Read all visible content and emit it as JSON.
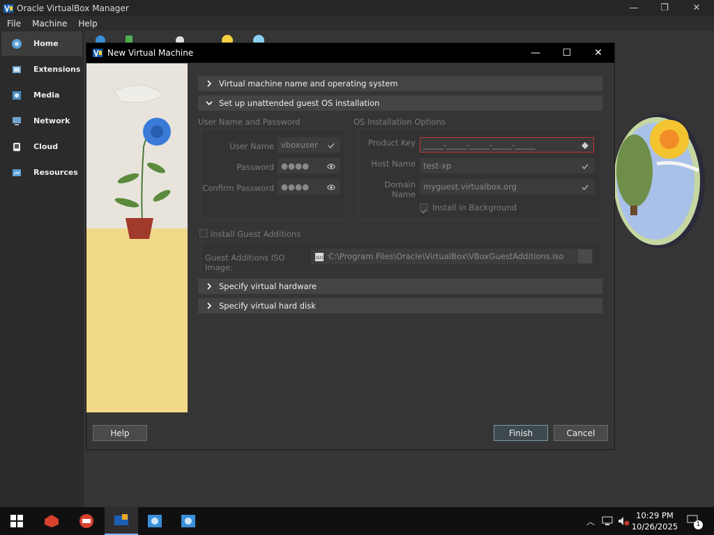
{
  "app": {
    "title": "Oracle VirtualBox Manager",
    "window_controls": {
      "minimize": "—",
      "restore": "❐",
      "close": "✕"
    }
  },
  "menu": [
    "File",
    "Machine",
    "Help"
  ],
  "sidebar": {
    "items": [
      {
        "label": "Home",
        "icon": "home-icon",
        "active": true
      },
      {
        "label": "Extensions",
        "icon": "extensions-icon"
      },
      {
        "label": "Media",
        "icon": "media-icon"
      },
      {
        "label": "Network",
        "icon": "network-icon"
      },
      {
        "label": "Cloud",
        "icon": "cloud-icon"
      },
      {
        "label": "Resources",
        "icon": "resources-icon"
      }
    ]
  },
  "dialog": {
    "title": "New Virtual Machine",
    "sections": {
      "name_os": "Virtual machine name and operating system",
      "unattended": "Set up unattended guest OS installation",
      "hardware": "Specify virtual hardware",
      "hard_disk": "Specify virtual hard disk"
    },
    "user_group": {
      "title": "User Name and Password",
      "username_label": "User Name",
      "username_value": "vboxuser",
      "password_label": "Password",
      "password_value": "●●●●",
      "confirm_label": "Confirm Password",
      "confirm_value": "●●●●"
    },
    "os_group": {
      "title": "OS Installation Options",
      "product_key_label": "Product Key",
      "product_key_value": "_____-_____-_____-_____-_____",
      "host_name_label": "Host Name",
      "host_name_value": "test-xp",
      "domain_name_label": "Domain Name",
      "domain_name_value": "myguest.virtualbox.org",
      "install_bg_label": "Install in Background",
      "install_bg_checked": true
    },
    "guest_additions": {
      "checkbox_label": "Install Guest Additions",
      "checked": false,
      "iso_label": "Guest Additions ISO Image:",
      "iso_path": "C:\\Program Files\\Oracle\\VirtualBox\\VBoxGuestAdditions.iso"
    },
    "buttons": {
      "help": "Help",
      "finish": "Finish",
      "cancel": "Cancel"
    }
  },
  "taskbar": {
    "time": "10:29 PM",
    "date": "10/26/2025",
    "notification_count": "1"
  }
}
